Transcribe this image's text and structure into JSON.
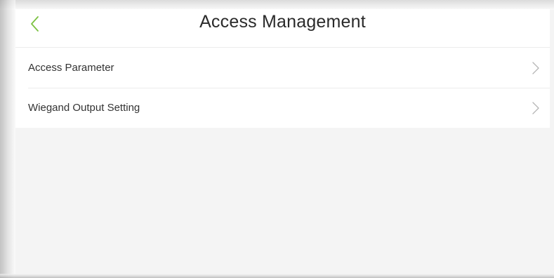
{
  "header": {
    "title": "Access Management",
    "back_icon": "chevron-left-icon",
    "accent_color": "#7cc242"
  },
  "menu": {
    "items": [
      {
        "label": "Access Parameter",
        "icon": "chevron-right-icon"
      },
      {
        "label": "Wiegand Output Setting",
        "icon": "chevron-right-icon"
      }
    ]
  }
}
